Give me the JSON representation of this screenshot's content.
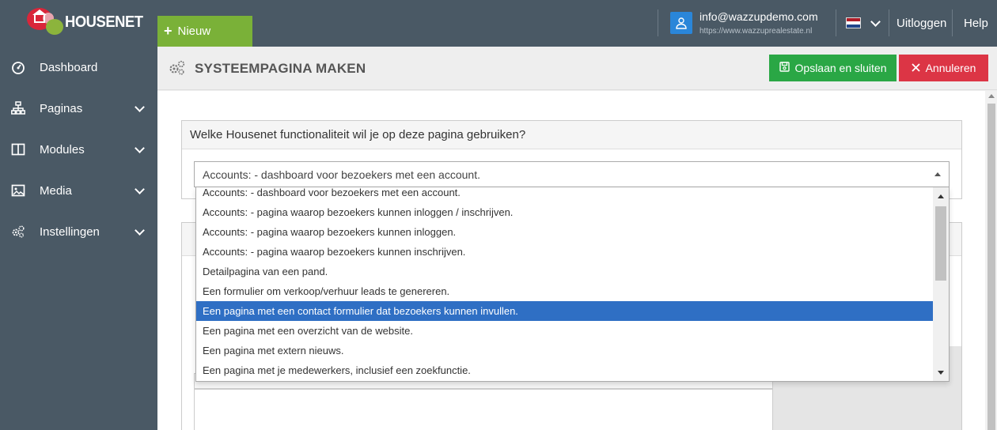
{
  "brand": {
    "name": "HOUSENET"
  },
  "topbar": {
    "new_label": "Nieuw",
    "user_email": "info@wazzupdemo.com",
    "user_site": "https://www.wazzuprealestate.nl",
    "logout_label": "Uitloggen",
    "help_label": "Help",
    "language_flag": "nl-flag-icon"
  },
  "sidebar": {
    "items": [
      {
        "label": "Dashboard",
        "icon": "dashboard-icon",
        "has_submenu": false
      },
      {
        "label": "Paginas",
        "icon": "sitemap-icon",
        "has_submenu": true
      },
      {
        "label": "Modules",
        "icon": "columns-icon",
        "has_submenu": true
      },
      {
        "label": "Media",
        "icon": "image-icon",
        "has_submenu": true
      },
      {
        "label": "Instellingen",
        "icon": "gears-icon",
        "has_submenu": true
      }
    ]
  },
  "page": {
    "title": "SYSTEEMPAGINA MAKEN",
    "save_label": "Opslaan en sluiten",
    "cancel_label": "Annuleren"
  },
  "form": {
    "question": "Welke Housenet functionaliteit wil je op deze pagina gebruiken?",
    "selected_value": "Accounts: - dashboard voor bezoekers met een account.",
    "options": [
      "Accounts: - dashboard voor bezoekers met een account.",
      "Accounts: - pagina waarop bezoekers kunnen inloggen / inschrijven.",
      "Accounts: - pagina waarop bezoekers kunnen inloggen.",
      "Accounts: - pagina waarop bezoekers kunnen inschrijven.",
      "Detailpagina van een pand.",
      "Een formulier om verkoop/verhuur leads te genereren.",
      "Een pagina met een contact formulier dat bezoekers kunnen invullen.",
      "Een pagina met een overzicht van de website.",
      "Een pagina met extern nieuws.",
      "Een pagina met je medewerkers, inclusief een zoekfunctie."
    ],
    "highlighted_option": "Een pagina met een contact formulier dat bezoekers kunnen invullen."
  },
  "colors": {
    "sidebar_bg": "#4a5965",
    "new_button": "#7ab138",
    "save_button": "#2aa745",
    "cancel_button": "#dc3545",
    "highlight": "#2f6fc4",
    "avatar": "#2a86d9"
  }
}
